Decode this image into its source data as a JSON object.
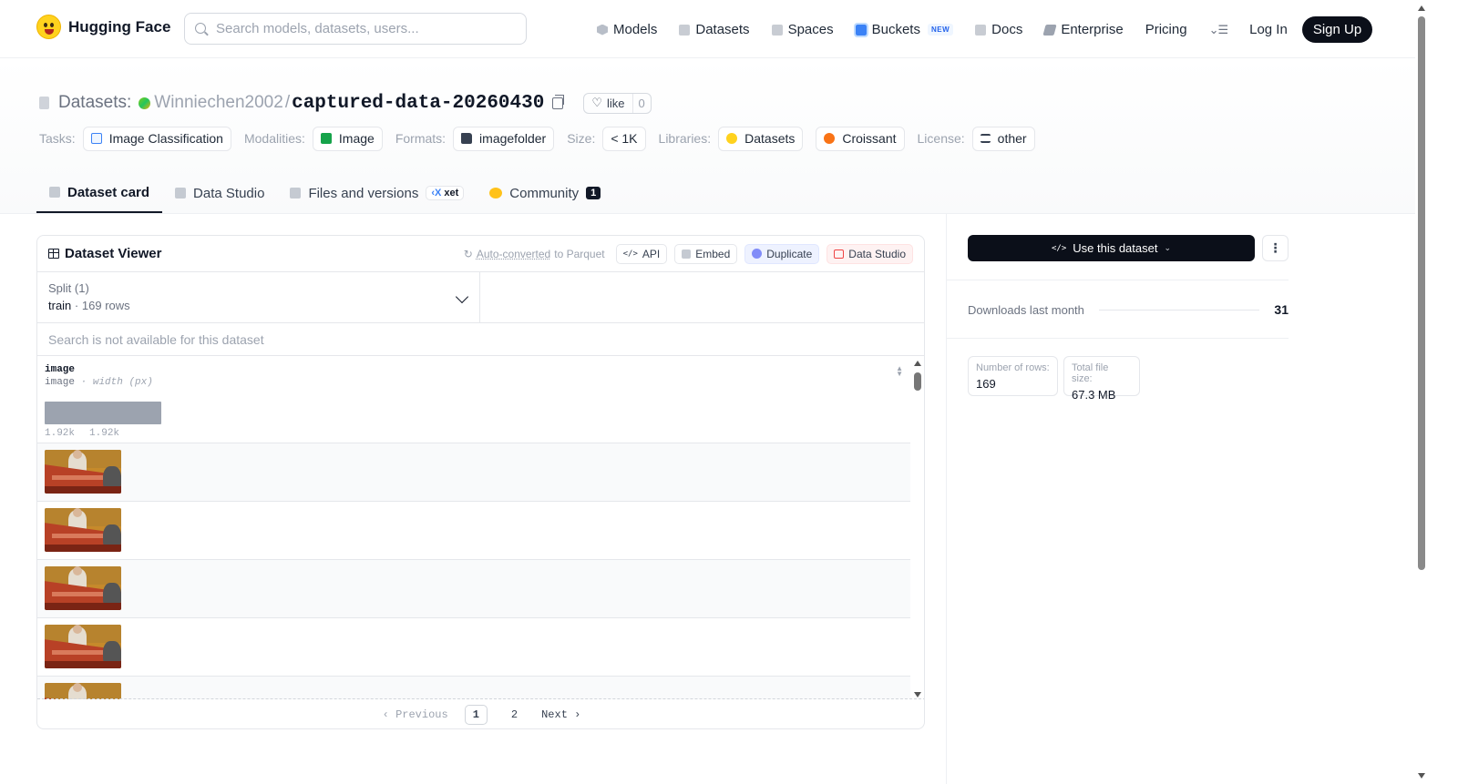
{
  "nav": {
    "brand": "Hugging Face",
    "search_placeholder": "Search models, datasets, users...",
    "links": [
      {
        "label": "Models",
        "icon": "cube-icon"
      },
      {
        "label": "Datasets",
        "icon": "database-icon"
      },
      {
        "label": "Spaces",
        "icon": "grid-icon"
      },
      {
        "label": "Buckets",
        "icon": "bucket-icon",
        "badge": "NEW"
      },
      {
        "label": "Docs",
        "icon": "book-icon"
      },
      {
        "label": "Enterprise",
        "icon": "enterprise-icon"
      },
      {
        "label": "Pricing"
      }
    ],
    "login": "Log In",
    "signup": "Sign Up"
  },
  "header": {
    "section": "Datasets:",
    "owner": "Winniechen2002",
    "separator": "/",
    "repo": "captured-data-20260430",
    "like_label": "like",
    "like_count": "0"
  },
  "tags": {
    "tasks_label": "Tasks:",
    "task": "Image Classification",
    "modalities_label": "Modalities:",
    "modality": "Image",
    "formats_label": "Formats:",
    "format": "imagefolder",
    "size_label": "Size:",
    "size": "< 1K",
    "libraries_label": "Libraries:",
    "libraries": [
      "Datasets",
      "Croissant"
    ],
    "license_label": "License:",
    "license": "other"
  },
  "tabs": {
    "dataset_card": "Dataset card",
    "data_studio": "Data Studio",
    "files": "Files and versions",
    "xet": "xet",
    "community": "Community",
    "community_count": "1"
  },
  "viewer": {
    "title": "Dataset Viewer",
    "auto_converted": "Auto-converted",
    "to_parquet": "to Parquet",
    "api": "API",
    "embed": "Embed",
    "duplicate": "Duplicate",
    "data_studio": "Data Studio",
    "split_label": "Split (1)",
    "split_name": "train",
    "split_sep": "·",
    "split_rows": "169 rows",
    "search_na": "Search is not available for this dataset",
    "column": {
      "name": "image",
      "type": "image",
      "type_sep": "·",
      "type_detail": "width (px)",
      "hist_min": "1.92k",
      "hist_max": "1.92k"
    },
    "pager": {
      "prev": "Previous",
      "pages": [
        "1",
        "2"
      ],
      "current": "1",
      "next": "Next"
    }
  },
  "sidebar": {
    "use_button": "Use this dataset",
    "downloads_label": "Downloads last month",
    "downloads_count": "31",
    "rows_label": "Number of rows:",
    "rows_value": "169",
    "size_label": "Total file size:",
    "size_value": "67.3 MB"
  },
  "colors": {
    "brand_yellow": "#ffd21e",
    "dark": "#0b0f19",
    "accent_blue": "#3b82f6"
  }
}
